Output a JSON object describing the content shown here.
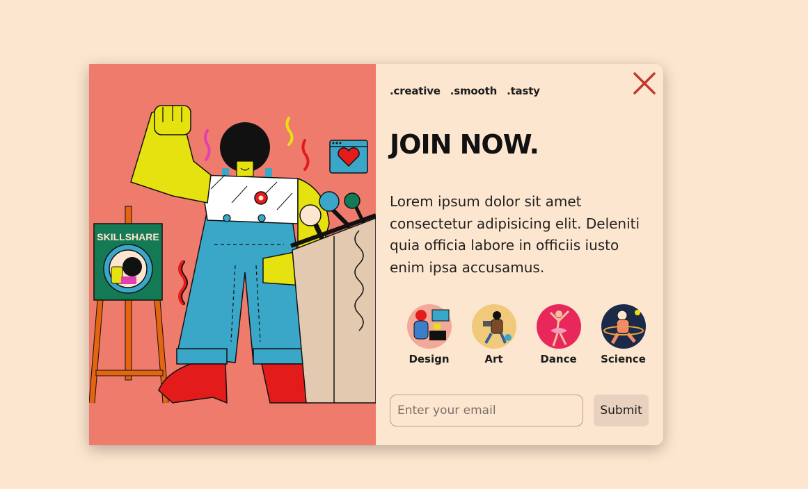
{
  "popup": {
    "tags": [
      ".creative",
      ".smooth",
      ".tasty"
    ],
    "title": "JOIN NOW.",
    "description": "Lorem ipsum dolor sit amet consectetur adipisicing elit. Deleniti quia officia labore in officiis iusto enim ipsa accusamus.",
    "categories": [
      {
        "label": "Design",
        "icon": "design-illustration-icon"
      },
      {
        "label": "Art",
        "icon": "art-illustration-icon"
      },
      {
        "label": "Dance",
        "icon": "dance-illustration-icon"
      },
      {
        "label": "Science",
        "icon": "science-illustration-icon"
      }
    ],
    "email_placeholder": "Enter your email",
    "email_value": "",
    "submit_label": "Submit",
    "close_icon": "close-icon"
  },
  "illustration": {
    "easel_sign_text": "SKILLSHARE",
    "icon": "speaker-at-podium-illustration"
  },
  "colors": {
    "page_background": "#fde6cf",
    "panel_left": "#ef7b6d",
    "close_icon": "#c0392b",
    "submit_background": "#e9d1bf"
  }
}
